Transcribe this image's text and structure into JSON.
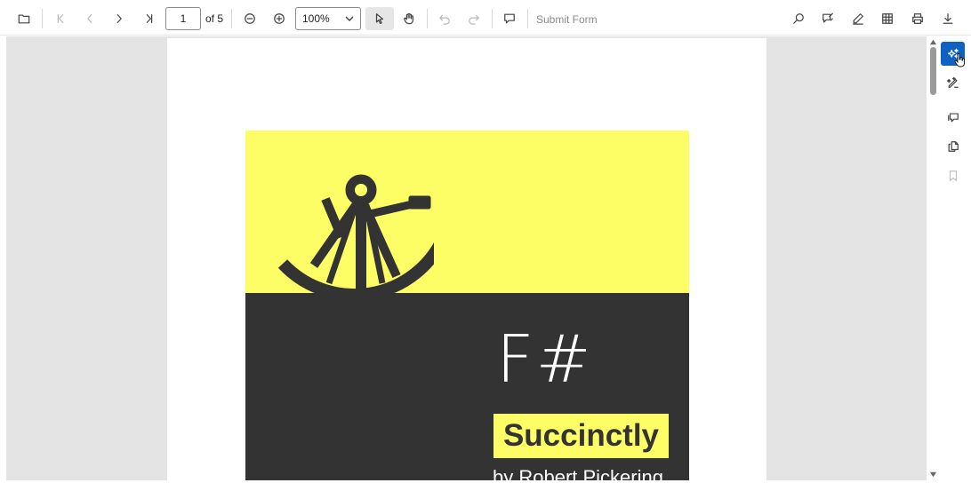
{
  "toolbar": {
    "open_icon": "folder-open-icon",
    "first_page_icon": "first-page-icon",
    "previous_page_icon": "previous-page-icon",
    "next_page_icon": "next-page-icon",
    "last_page_icon": "last-page-icon",
    "current_page": "1",
    "page_count_label": "of 5",
    "zoom_out_icon": "zoom-out-icon",
    "zoom_in_icon": "zoom-in-icon",
    "zoom_value": "100%",
    "selection_tool_icon": "text-select-cursor-icon",
    "pan_tool_icon": "pan-hand-icon",
    "undo_icon": "undo-icon",
    "redo_icon": "redo-icon",
    "comment_icon": "comment-icon",
    "submit_form_label": "Submit Form",
    "search_icon": "search-icon",
    "annotation_icon": "annotation-icon",
    "draw_icon": "pen-icon",
    "form_designer_icon": "form-grid-icon",
    "print_icon": "print-icon",
    "download_icon": "download-icon"
  },
  "document": {
    "cover_title": "F#",
    "cover_subtitle": "Succinctly",
    "cover_author": "by Robert Pickering",
    "cover_illustration": "sextant-illustration",
    "colors": {
      "cover_yellow": "#fdfd66",
      "cover_dark": "#333333",
      "page_bg": "#ffffff",
      "viewer_bg": "#e4e4e4"
    }
  },
  "sidebar": {
    "items": [
      {
        "icon": "magic-sparkle-icon",
        "selected": true
      },
      {
        "icon": "smart-pen-icon",
        "selected": false
      },
      {
        "icon": "comments-panel-icon",
        "selected": false
      },
      {
        "icon": "page-thumbnails-icon",
        "selected": false
      },
      {
        "icon": "bookmark-icon",
        "selected": false,
        "disabled": true
      }
    ],
    "accent_color": "#0f62c4"
  }
}
